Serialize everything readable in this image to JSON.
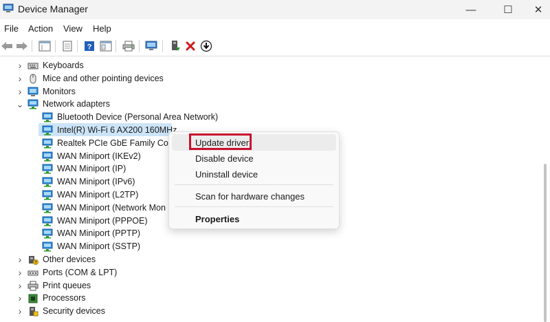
{
  "window": {
    "title": "Device Manager",
    "minimize_glyph": "—",
    "maximize_glyph": "☐",
    "close_glyph": "✕"
  },
  "menu": [
    "File",
    "Action",
    "View",
    "Help"
  ],
  "toolbar": {
    "icons": [
      "back-arrow-icon",
      "forward-arrow-icon",
      "properties-sheet-icon",
      "page-icon",
      "help-icon",
      "view-pane-icon",
      "print-icon",
      "scan-monitor-icon",
      "update-driver-icon",
      "uninstall-x-icon",
      "download-circle-icon"
    ]
  },
  "tree": {
    "rows": [
      {
        "label": "Keyboards",
        "indent": 0,
        "expander": "collapsed",
        "icon": "keyboard-icon"
      },
      {
        "label": "Mice and other pointing devices",
        "indent": 0,
        "expander": "collapsed",
        "icon": "mouse-icon"
      },
      {
        "label": "Monitors",
        "indent": 0,
        "expander": "collapsed",
        "icon": "monitor-icon"
      },
      {
        "label": "Network adapters",
        "indent": 0,
        "expander": "expanded",
        "icon": "network-icon"
      },
      {
        "label": "Bluetooth Device (Personal Area Network)",
        "indent": 1,
        "expander": "none",
        "icon": "network-icon"
      },
      {
        "label": "Intel(R) Wi-Fi 6 AX200 160MHz",
        "indent": 1,
        "expander": "none",
        "icon": "network-icon",
        "selected": true
      },
      {
        "label": "Realtek PCIe GbE Family Contr",
        "indent": 1,
        "expander": "none",
        "icon": "network-icon"
      },
      {
        "label": "WAN Miniport (IKEv2)",
        "indent": 1,
        "expander": "none",
        "icon": "network-icon"
      },
      {
        "label": "WAN Miniport (IP)",
        "indent": 1,
        "expander": "none",
        "icon": "network-icon"
      },
      {
        "label": "WAN Miniport (IPv6)",
        "indent": 1,
        "expander": "none",
        "icon": "network-icon"
      },
      {
        "label": "WAN Miniport (L2TP)",
        "indent": 1,
        "expander": "none",
        "icon": "network-icon"
      },
      {
        "label": "WAN Miniport (Network Mon",
        "indent": 1,
        "expander": "none",
        "icon": "network-icon"
      },
      {
        "label": "WAN Miniport (PPPOE)",
        "indent": 1,
        "expander": "none",
        "icon": "network-icon"
      },
      {
        "label": "WAN Miniport (PPTP)",
        "indent": 1,
        "expander": "none",
        "icon": "network-icon"
      },
      {
        "label": "WAN Miniport (SSTP)",
        "indent": 1,
        "expander": "none",
        "icon": "network-icon"
      },
      {
        "label": "Other devices",
        "indent": 0,
        "expander": "collapsed",
        "icon": "other-devices-icon"
      },
      {
        "label": "Ports (COM & LPT)",
        "indent": 0,
        "expander": "collapsed",
        "icon": "port-icon"
      },
      {
        "label": "Print queues",
        "indent": 0,
        "expander": "collapsed",
        "icon": "printer-icon"
      },
      {
        "label": "Processors",
        "indent": 0,
        "expander": "collapsed",
        "icon": "processor-icon"
      },
      {
        "label": "Security devices",
        "indent": 0,
        "expander": "collapsed",
        "icon": "security-icon"
      }
    ]
  },
  "context_menu": {
    "update_driver": "Update driver",
    "disable_device": "Disable device",
    "uninstall_device": "Uninstall device",
    "scan_hardware": "Scan for hardware changes",
    "properties": "Properties"
  },
  "colors": {
    "highlight_box": "#c8102e",
    "selection": "#cce4f7",
    "network_icon": "#2b88d8"
  }
}
